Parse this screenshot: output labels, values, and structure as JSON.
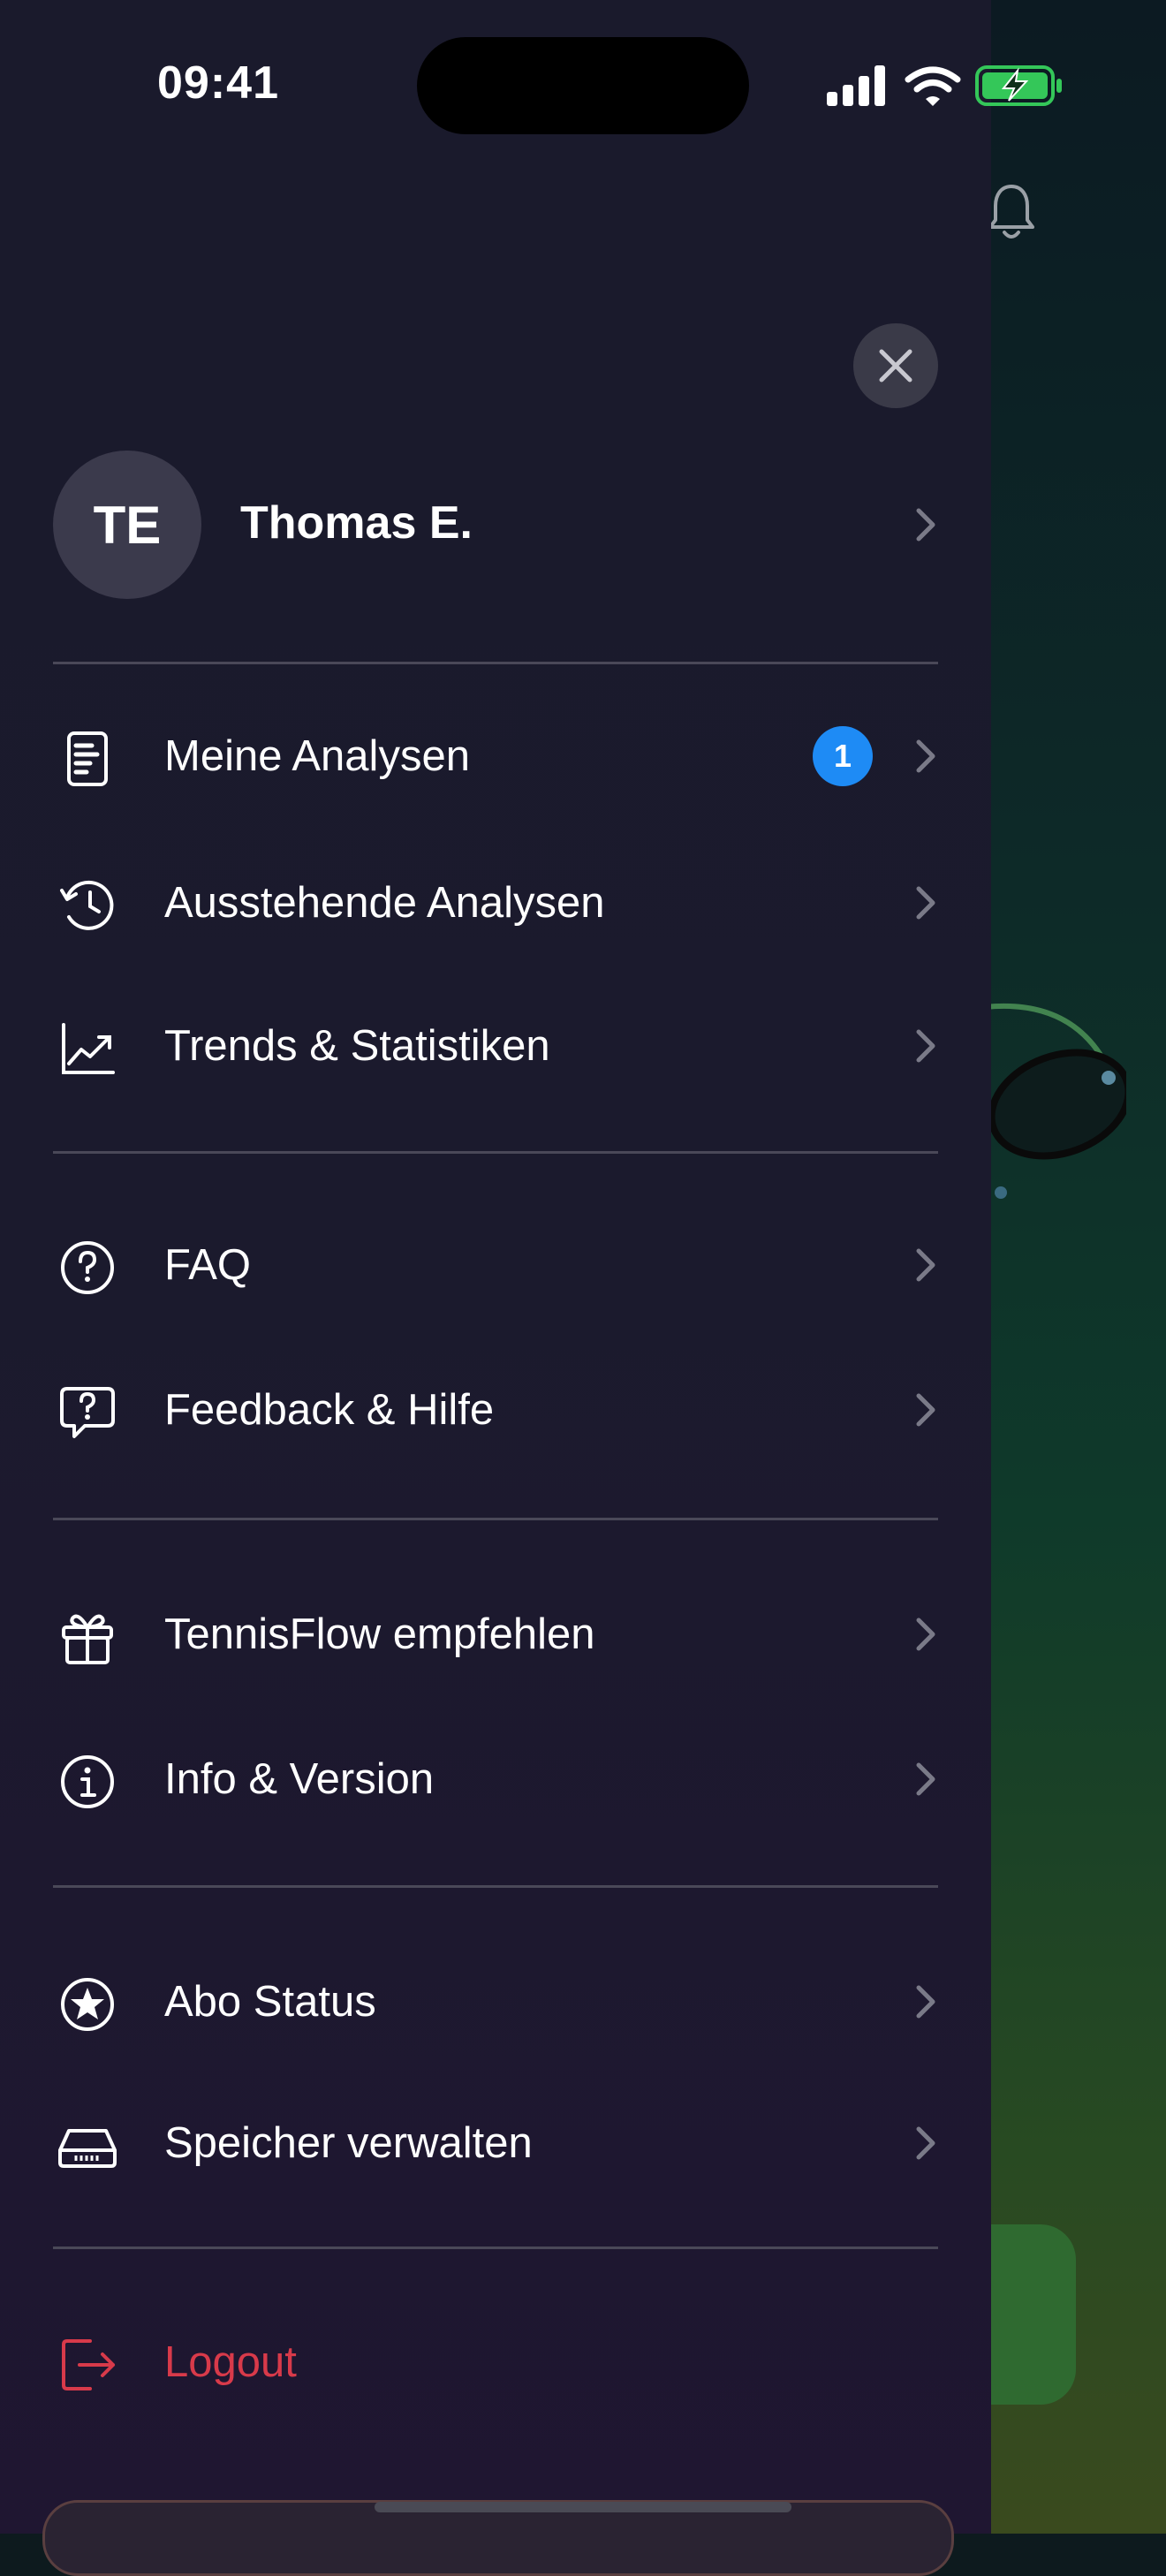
{
  "status_bar": {
    "time": "09:41"
  },
  "profile": {
    "initials": "TE",
    "name": "Thomas E."
  },
  "menu": {
    "section1": [
      {
        "label": "Meine Analysen",
        "icon": "document-icon",
        "badge": "1"
      },
      {
        "label": "Ausstehende Analysen",
        "icon": "history-clock-icon"
      },
      {
        "label": "Trends & Statistiken",
        "icon": "trend-chart-icon"
      }
    ],
    "section2": [
      {
        "label": "FAQ",
        "icon": "question-circle-icon"
      },
      {
        "label": "Feedback & Hilfe",
        "icon": "question-bubble-icon"
      }
    ],
    "section3": [
      {
        "label": "TennisFlow empfehlen",
        "icon": "gift-icon"
      },
      {
        "label": "Info & Version",
        "icon": "info-circle-icon"
      }
    ],
    "section4": [
      {
        "label": "Abo Status",
        "icon": "star-circle-icon"
      },
      {
        "label": "Speicher verwalten",
        "icon": "storage-drive-icon"
      }
    ],
    "logout": {
      "label": "Logout",
      "icon": "logout-icon"
    }
  },
  "colors": {
    "drawer_bg": "#1b1a2d",
    "badge": "#1e8bf5",
    "logout": "#d83a4a",
    "battery": "#34c759"
  }
}
